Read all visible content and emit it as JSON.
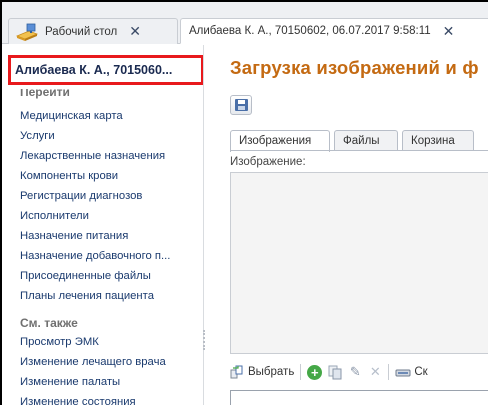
{
  "tabs": {
    "desktop_label": "Рабочий стол",
    "patient_label": "Алибаева К. А., 70150602, 06.07.2017 9:58:11",
    "close_glyph": "✕"
  },
  "left_panel": {
    "patient_title": "Алибаева К. А., 7015060...",
    "goto_header": "Перейти",
    "goto_items": [
      "Медицинская карта",
      "Услуги",
      "Лекарственные назначения",
      "Компоненты крови",
      "Регистрации диагнозов",
      "Исполнители",
      "Назначение питания",
      "Назначение добавочного п...",
      "Присоединенные файлы",
      "Планы лечения пациента"
    ],
    "seealso_header": "См. также",
    "seealso_items": [
      "Просмотр ЭМК",
      "Изменение лечащего врача",
      "Изменение палаты",
      "Изменение состояния"
    ]
  },
  "main": {
    "title": "Загрузка изображений и ф",
    "inner_tabs": [
      "Изображения",
      "Файлы",
      "Корзина"
    ],
    "field_label": "Изображение:",
    "toolbar": {
      "select_label": "Выбрать",
      "scan_label": "Ск"
    }
  },
  "colors": {
    "title_orange": "#c46a12",
    "highlight_red": "#e8191c",
    "link_blue": "#1a3a6e"
  },
  "icons": [
    "desktop-icon",
    "close-icon",
    "save-icon",
    "select-icon",
    "add-icon",
    "copy-icon",
    "edit-icon",
    "delete-icon",
    "scan-icon"
  ]
}
